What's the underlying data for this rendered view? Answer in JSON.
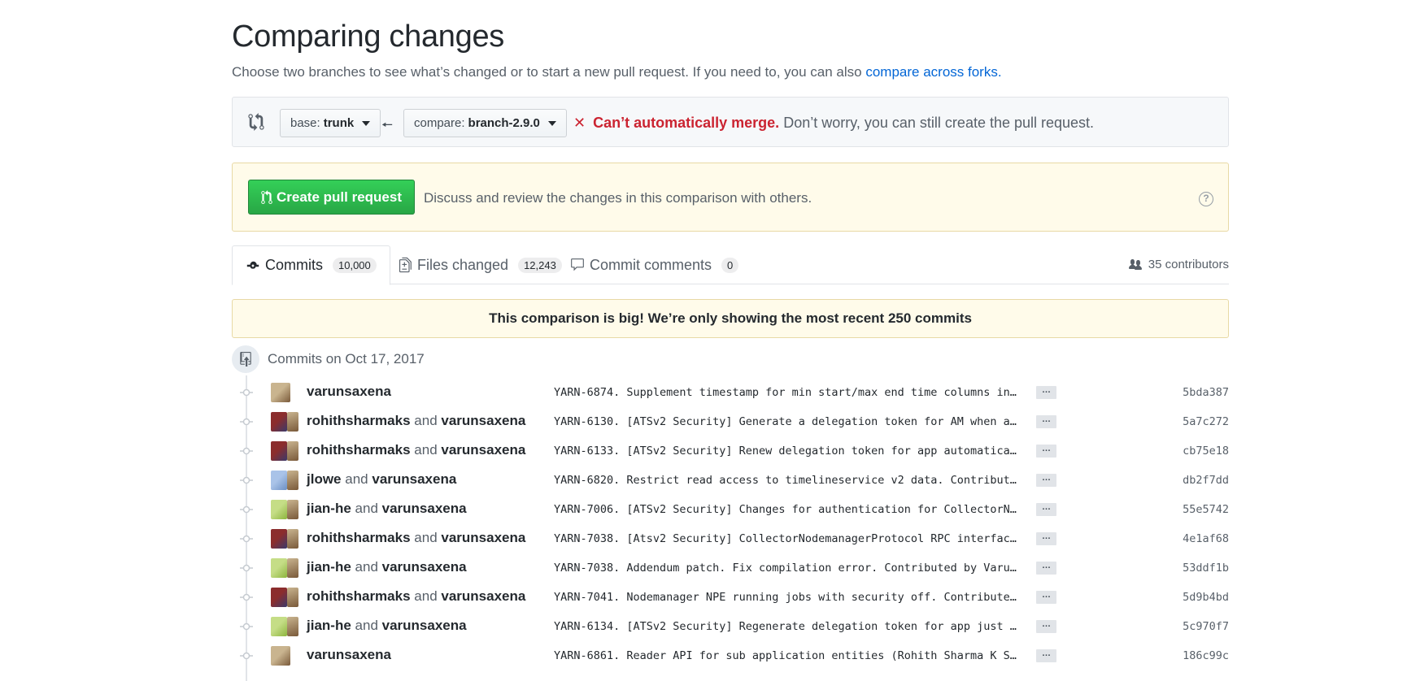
{
  "header": {
    "title": "Comparing changes",
    "subtitle": "Choose two branches to see what’s changed or to start a new pull request. If you need to, you can also",
    "subtitle_link": "compare across forks."
  },
  "range": {
    "base_label": "base:",
    "base_value": "trunk",
    "compare_label": "compare:",
    "compare_value": "branch-2.9.0",
    "merge_status": "Can’t automatically merge.",
    "merge_note": "Don’t worry, you can still create the pull request."
  },
  "pull_request": {
    "button_label": "Create pull request",
    "description": "Discuss and review the changes in this comparison with others."
  },
  "tabs": [
    {
      "label": "Commits",
      "count": "10,000"
    },
    {
      "label": "Files changed",
      "count": "12,243"
    },
    {
      "label": "Commit comments",
      "count": "0"
    }
  ],
  "contributors": "35 contributors",
  "flash": "This comparison is big! We’re only showing the most recent 250 commits",
  "day": "Commits on Oct 17, 2017",
  "commits": [
    {
      "author": "varunsaxena",
      "coauthor": "",
      "message": "YARN-6874. Supplement timestamp for min start/max end time columns in…",
      "sha": "5bda387"
    },
    {
      "author": "rohithsharmaks",
      "coauthor": "varunsaxena",
      "message": "YARN-6130. [ATSv2 Security] Generate a delegation token for AM when a…",
      "sha": "5a7c272"
    },
    {
      "author": "rohithsharmaks",
      "coauthor": "varunsaxena",
      "message": "YARN-6133. [ATSv2 Security] Renew delegation token for app automatica…",
      "sha": "cb75e18"
    },
    {
      "author": "jlowe",
      "coauthor": "varunsaxena",
      "message": "YARN-6820. Restrict read access to timelineservice v2 data. Contribut…",
      "sha": "db2f7dd"
    },
    {
      "author": "jian-he",
      "coauthor": "varunsaxena",
      "message": "YARN-7006. [ATSv2 Security] Changes for authentication for CollectorN…",
      "sha": "55e5742"
    },
    {
      "author": "rohithsharmaks",
      "coauthor": "varunsaxena",
      "message": "YARN-7038. [Atsv2 Security] CollectorNodemanagerProtocol RPC interfac…",
      "sha": "4e1af68"
    },
    {
      "author": "jian-he",
      "coauthor": "varunsaxena",
      "message": "YARN-7038. Addendum patch. Fix compilation error. Contributed by Varu…",
      "sha": "53ddf1b"
    },
    {
      "author": "rohithsharmaks",
      "coauthor": "varunsaxena",
      "message": "YARN-7041. Nodemanager NPE running jobs with security off. Contribute…",
      "sha": "5d9b4bd"
    },
    {
      "author": "jian-he",
      "coauthor": "varunsaxena",
      "message": "YARN-6134. [ATSv2 Security] Regenerate delegation token for app just …",
      "sha": "5c970f7"
    },
    {
      "author": "varunsaxena",
      "coauthor": "",
      "message": "YARN-6861. Reader API for sub application entities (Rohith Sharma K S…",
      "sha": "186c99c"
    }
  ],
  "and_word": "and",
  "ellipsis": "…",
  "colors": {
    "link": "#0366d6",
    "error": "#cb2431",
    "green": "#28a745",
    "flash_bg": "#fffbea"
  }
}
